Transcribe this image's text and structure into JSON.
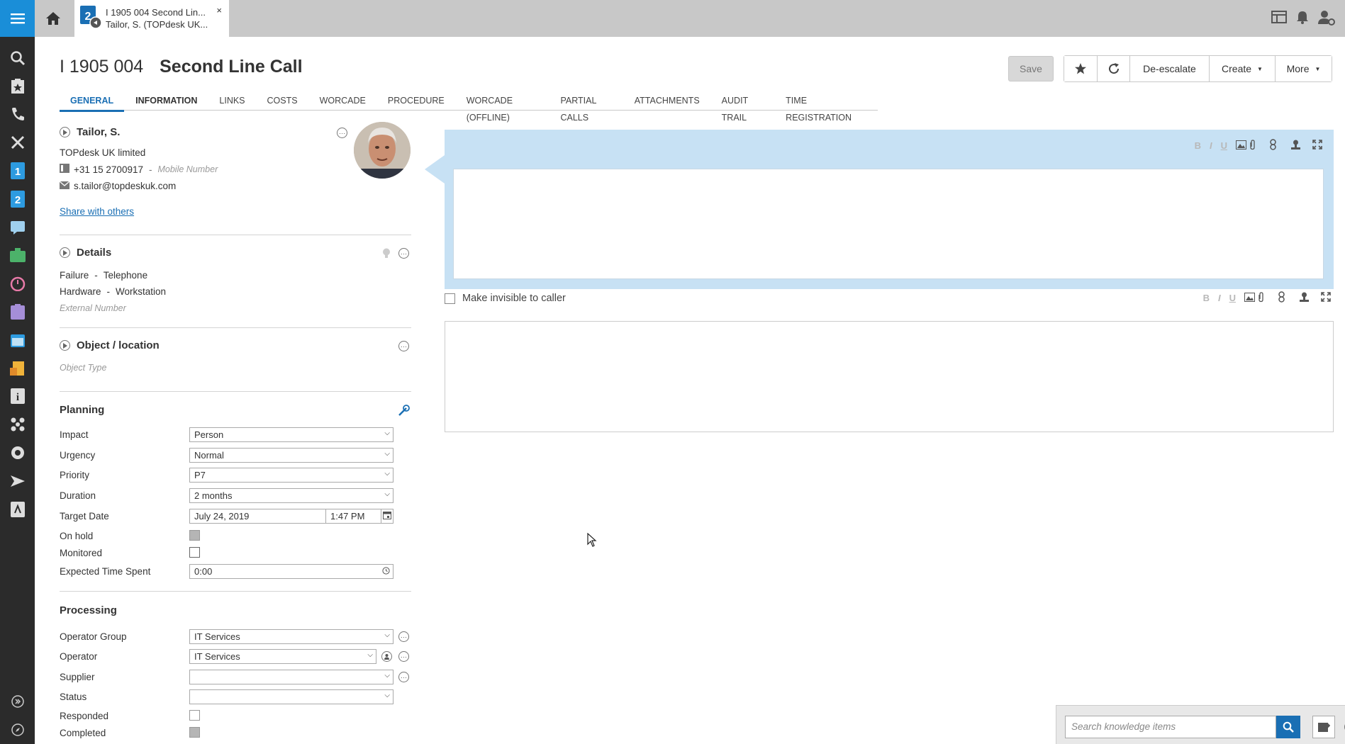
{
  "tab": {
    "line1": "I 1905 004 Second Lin...",
    "line2": "Tailor, S. (TOPdesk UK...",
    "close": "×"
  },
  "header": {
    "number": "I 1905 004",
    "title": "Second Line Call"
  },
  "actions": {
    "save": "Save",
    "deescalate": "De-escalate",
    "create": "Create",
    "more": "More"
  },
  "tabs": [
    "GENERAL",
    "INFORMATION",
    "LINKS",
    "COSTS",
    "WORCADE",
    "PROCEDURE",
    "WORCADE (OFFLINE)",
    "PARTIAL CALLS",
    "ATTACHMENTS",
    "AUDIT TRAIL",
    "TIME REGISTRATION"
  ],
  "caller": {
    "name": "Tailor, S.",
    "company": "TOPdesk UK limited",
    "phone": "+31 15 2700917",
    "phone_sep": "-",
    "mobile_placeholder": "Mobile Number",
    "email": "s.tailor@topdeskuk.com",
    "share": "Share with others"
  },
  "details": {
    "title": "Details",
    "line1a": "Failure",
    "line1b": "Telephone",
    "line2a": "Hardware",
    "line2b": "Workstation",
    "sep": "-",
    "external_placeholder": "External Number"
  },
  "object": {
    "title": "Object / location",
    "type_placeholder": "Object Type"
  },
  "planning": {
    "title": "Planning",
    "impact_label": "Impact",
    "impact": "Person",
    "urgency_label": "Urgency",
    "urgency": "Normal",
    "priority_label": "Priority",
    "priority": "P7",
    "duration_label": "Duration",
    "duration": "2 months",
    "target_label": "Target Date",
    "target_date": "July 24, 2019",
    "target_time": "1:47 PM",
    "onhold_label": "On hold",
    "monitored_label": "Monitored",
    "expected_label": "Expected Time Spent",
    "expected": "0:00"
  },
  "processing": {
    "title": "Processing",
    "group_label": "Operator Group",
    "group": "IT Services",
    "operator_label": "Operator",
    "operator": "IT Services",
    "supplier_label": "Supplier",
    "supplier": "",
    "status_label": "Status",
    "status": "",
    "responded_label": "Responded",
    "completed_label": "Completed"
  },
  "editor": {
    "invisible_label": "Make invisible to caller"
  },
  "toolbar": {
    "bold": "B",
    "italic": "I",
    "underline": "U"
  },
  "knowledge": {
    "placeholder": "Search knowledge items"
  },
  "colors": {
    "accent": "#1a6fb4",
    "sidebar": "#2b2b2b",
    "menu": "#1a8ed8",
    "editor_bg": "#c7e1f4"
  }
}
